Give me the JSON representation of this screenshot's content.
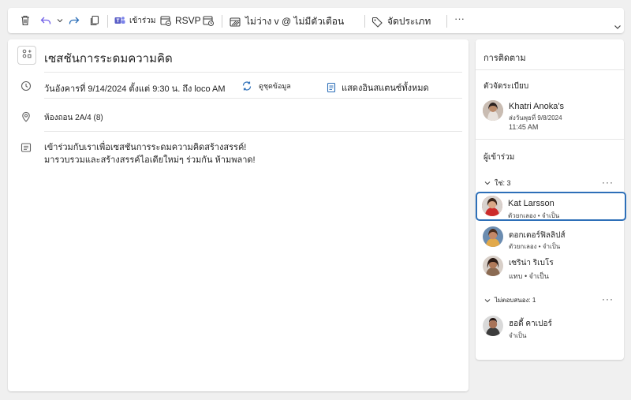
{
  "toolbar": {
    "teams_label": "เข้าร่วม",
    "rsvp_label": "RSVP",
    "busy_label": "ไม่ว่าง v @ ไม่มีตัวเตือน",
    "categorize_label": "จัดประเภท",
    "more_label": "···"
  },
  "event": {
    "title": "เซสชันการระดมความคิด",
    "datetime": "วันอังคารที่ 9/14/2024 ตั้งแต่ 9:30 น. ถึง loco AM",
    "repeat_label": "ดูชุดข้อมูล",
    "show_all_label": "แสดงอินสแตนซ์ทั้งหมด",
    "location": "ห้องถอน 2A/4 (8)",
    "description_line1": "เข้าร่วมกับเราเพื่อเซสชันการระดมความคิดสร้างสรรค์!",
    "description_line2": "มารวบรวมและสร้างสรรค์ไอเดียใหม่ๆ ร่วมกัน ห้ามพลาด!"
  },
  "side": {
    "tracking_title": "การติดตาม",
    "organizer_title": "ตัวจัดระเบียบ",
    "organizer": {
      "name": "Khatri Anoka's",
      "sub1": "ส่งวันพุธที่ 9/8/2024",
      "sub2": "11:45 AM"
    },
    "attendees_title": "ผู้เข้าร่วม",
    "accepted_group": "ใช่: 3",
    "attendees": [
      {
        "name": "Kat Larsson",
        "sub": "ตัวยกเลอง • จำเป็น"
      },
      {
        "name": "ดอกเตอร์ฟิลลิปส์",
        "sub": "ตัวยกเลอง • จำเป็น"
      },
      {
        "name": "เซริน่า ริเบโร",
        "sub": "แทบ • จำเป็น"
      }
    ],
    "no_response_group": "ไม่ตอบสนอง: 1",
    "no_response": [
      {
        "name": "ฮอดี้ คาเปอร์",
        "sub": "จำเป็น"
      }
    ],
    "more_label": "···"
  },
  "colors": {
    "accent": "#2d6fb8",
    "undo": "#7160e8",
    "teams": "#5b5fc7"
  }
}
